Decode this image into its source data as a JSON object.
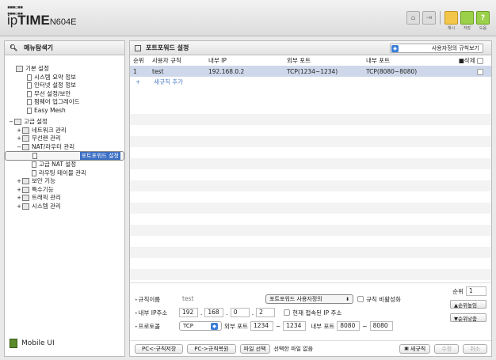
{
  "header": {
    "brand": "ipTIME",
    "brand_pre": "ip",
    "brand_bold": "TIME",
    "model": "N604E",
    "buttons": [
      {
        "icon": "home-icon"
      },
      {
        "icon": "logout-icon"
      },
      {
        "icon": "restart-icon",
        "label": "재시"
      },
      {
        "icon": "save-icon",
        "label": "저장"
      },
      {
        "icon": "help-icon",
        "label": "도움"
      }
    ]
  },
  "sidebar": {
    "title": "메뉴탐색기",
    "tree": [
      {
        "label": "기본 설정",
        "level": 0,
        "icon": "folder"
      },
      {
        "label": "시스템 요약 정보",
        "level": 1,
        "icon": "page"
      },
      {
        "label": "인터넷 설정 정보",
        "level": 1,
        "icon": "page"
      },
      {
        "label": "무선 설정/보안",
        "level": 1,
        "icon": "page"
      },
      {
        "label": "펌웨어 업그레이드",
        "level": 1,
        "icon": "page"
      },
      {
        "label": "Easy Mesh",
        "level": 1,
        "icon": "page"
      },
      {
        "label": "고급 설정",
        "level": 0,
        "icon": "folder",
        "toggle": "−"
      },
      {
        "label": "네트워크 관리",
        "level": 1,
        "icon": "folder",
        "toggle": "+"
      },
      {
        "label": "무선랜 관리",
        "level": 1,
        "icon": "folder",
        "toggle": "+"
      },
      {
        "label": "NAT/라우터 관리",
        "level": 1,
        "icon": "folder",
        "toggle": "−"
      },
      {
        "label": "포트포워드 설정",
        "level": 2,
        "icon": "page",
        "selected": true
      },
      {
        "label": "고급 NAT 설정",
        "level": 2,
        "icon": "page"
      },
      {
        "label": "라우팅 테이블 관리",
        "level": 2,
        "icon": "page"
      },
      {
        "label": "보안 기능",
        "level": 1,
        "icon": "folder",
        "toggle": "+"
      },
      {
        "label": "특수기능",
        "level": 1,
        "icon": "folder",
        "toggle": "+"
      },
      {
        "label": "트래픽 관리",
        "level": 1,
        "icon": "folder",
        "toggle": "+"
      },
      {
        "label": "시스템 관리",
        "level": 1,
        "icon": "folder",
        "toggle": "+"
      }
    ],
    "mobile_label": "Mobile UI"
  },
  "main": {
    "title": "포트포워드 설정",
    "view_select": "사용자정의 규칙보기",
    "columns": [
      "순위",
      "사용자 규칙",
      "내부 IP",
      "외부 포트",
      "내부 포트",
      "■삭제"
    ],
    "rows": [
      {
        "rank": "1",
        "name": "test",
        "ip": "192.168.0.2",
        "ext_port": "TCP(1234~1234)",
        "int_port": "TCP(8080~8080)"
      }
    ],
    "add_rule": "새규칙 추가",
    "form": {
      "rule_name_label": "규칙이름",
      "rule_name_value": "test",
      "rule_type": "포트포워드 사용자정의",
      "disable_label": "규칙 비활성화",
      "rank_label": "순위",
      "rank_value": "1",
      "rank_up": "▲순위높임",
      "rank_down": "▼순위낮춤",
      "ip_label": "내부 IP주소",
      "ip1": "192",
      "ip2": "168",
      "ip3": "0",
      "ip4": "2",
      "current_ip_label": "현재 접속된 IP 주소",
      "protocol_label": "프로토콜",
      "protocol_value": "TCP",
      "ext_port_label": "외부 포트",
      "ext_from": "1234",
      "ext_to": "1234",
      "int_port_label": "내부 포트",
      "int_from": "8080",
      "int_to": "8080",
      "tilde": "~",
      "dot": "."
    },
    "bottom": {
      "pc_to_rules": "PC<-규칙저장",
      "pc_from_rules": "PC->규칙복원",
      "file_select": "파일 선택",
      "no_file": "선택한 파일 없음",
      "new_rule": "새규칙",
      "modify": "수정",
      "cancel": "취소"
    }
  }
}
